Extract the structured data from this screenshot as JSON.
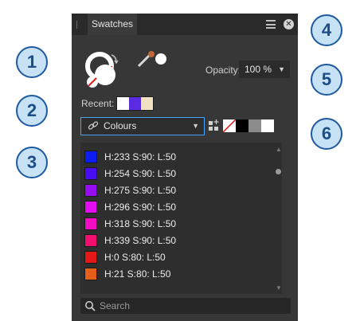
{
  "callouts": [
    "1",
    "2",
    "3",
    "4",
    "5",
    "6"
  ],
  "panel": {
    "tab_label": "Swatches",
    "menu_icon": "hamburger-menu-icon",
    "close_icon": "close-icon"
  },
  "opacity": {
    "label": "Opacity:",
    "value": "100 %"
  },
  "recent": {
    "label": "Recent:",
    "colors": [
      "#ffffff",
      "#5a2be0",
      "#f2e2c4"
    ]
  },
  "category": {
    "label": "Colours",
    "icon": "link-icon"
  },
  "quick_colors": [
    "none",
    "#000000",
    "#8c8c8c",
    "#ffffff"
  ],
  "swatches": [
    {
      "label": "H:233 S:90: L:50",
      "color": "#0d1cf2"
    },
    {
      "label": "H:254 S:90: L:50",
      "color": "#480df2"
    },
    {
      "label": "H:275 S:90: L:50",
      "color": "#960df2"
    },
    {
      "label": "H:296 S:90: L:50",
      "color": "#e40df2"
    },
    {
      "label": "H:318 S:90: L:50",
      "color": "#f20dc4"
    },
    {
      "label": "H:339 S:90: L:50",
      "color": "#f20d6e"
    },
    {
      "label": "H:0 S:80: L:50",
      "color": "#e61919"
    },
    {
      "label": "H:21 S:80: L:50",
      "color": "#e65e19"
    }
  ],
  "search": {
    "placeholder": "Search"
  }
}
